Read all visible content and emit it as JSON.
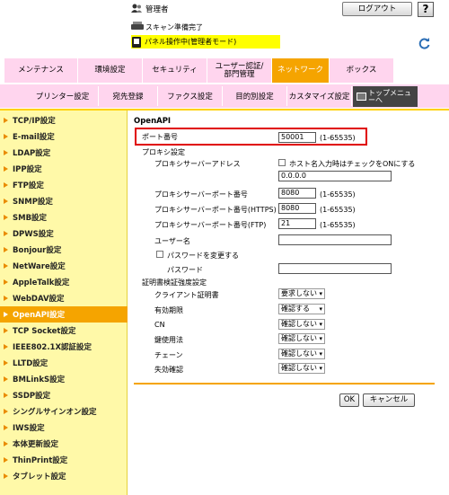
{
  "header": {
    "admin_label": "管理者",
    "logout_label": "ログアウト",
    "help_label": "?",
    "scan_status": "スキャン準備完了",
    "panel_status": "パネル操作中(管理者モード)"
  },
  "top_tabs": [
    {
      "label": "メンテナンス",
      "color": "#ffd5ee"
    },
    {
      "label": "環境設定",
      "color": "#ffd5ee"
    },
    {
      "label": "セキュリティ",
      "color": "#ffd5ee"
    },
    {
      "label": "ユーザー認証/部門管理",
      "color": "#ffd5ee"
    },
    {
      "label": "ネットワーク",
      "color": "#f5a400"
    },
    {
      "label": "ボックス",
      "color": "#ffd5ee"
    }
  ],
  "sub_tabs": [
    {
      "label": "プリンター設定"
    },
    {
      "label": "宛先登録"
    },
    {
      "label": "ファクス設定"
    },
    {
      "label": "目的別設定"
    },
    {
      "label": "カスタマイズ設定"
    }
  ],
  "top_menu_label": "トップメニューへ",
  "sidebar": {
    "items": [
      {
        "label": "TCP/IP設定"
      },
      {
        "label": "E-mail設定"
      },
      {
        "label": "LDAP設定"
      },
      {
        "label": "IPP設定"
      },
      {
        "label": "FTP設定"
      },
      {
        "label": "SNMP設定"
      },
      {
        "label": "SMB設定"
      },
      {
        "label": "DPWS設定"
      },
      {
        "label": "Bonjour設定"
      },
      {
        "label": "NetWare設定"
      },
      {
        "label": "AppleTalk設定"
      },
      {
        "label": "WebDAV設定"
      },
      {
        "label": "OpenAPI設定"
      },
      {
        "label": "TCP Socket設定"
      },
      {
        "label": "IEEE802.1X認証設定"
      },
      {
        "label": "LLTD設定"
      },
      {
        "label": "BMLinkS設定"
      },
      {
        "label": "SSDP設定"
      },
      {
        "label": "シングルサインオン設定"
      },
      {
        "label": "IWS設定"
      },
      {
        "label": "本体更新設定"
      },
      {
        "label": "ThinPrint設定"
      },
      {
        "label": "タブレット設定"
      }
    ],
    "active_index": 12
  },
  "form": {
    "section_title": "OpenAPI",
    "port_label": "ポート番号",
    "port_value": "50001",
    "port_range": "(1-65535)",
    "proxy_heading": "プロキシ設定",
    "proxy_address_label": "プロキシサーバーアドレス",
    "host_checkbox_label": "ホスト名入力時はチェックをONにする",
    "proxy_address_value": "0.0.0.0",
    "proxy_port_label": "プロキシサーバーポート番号",
    "proxy_port_value": "8080",
    "proxy_port_range": "(1-65535)",
    "proxy_port_https_label": "プロキシサーバーポート番号(HTTPS)",
    "proxy_port_https_value": "8080",
    "proxy_port_https_range": "(1-65535)",
    "proxy_port_ftp_label": "プロキシサーバーポート番号(FTP)",
    "proxy_port_ftp_value": "21",
    "proxy_port_ftp_range": "(1-65535)",
    "username_label": "ユーザー名",
    "username_value": "",
    "change_password_label": "パスワードを変更する",
    "password_label": "パスワード",
    "password_value": "",
    "cert_heading": "証明書検証強度設定",
    "cert_rows": [
      {
        "label": "クライアント証明書",
        "value": "要求しない"
      },
      {
        "label": "有効期限",
        "value": "確認する"
      },
      {
        "label": "CN",
        "value": "確認しない"
      },
      {
        "label": "鍵使用法",
        "value": "確認しない"
      },
      {
        "label": "チェーン",
        "value": "確認しない"
      },
      {
        "label": "失効確認",
        "value": "確認しない"
      }
    ],
    "ok_label": "OK",
    "cancel_label": "キャンセル"
  }
}
